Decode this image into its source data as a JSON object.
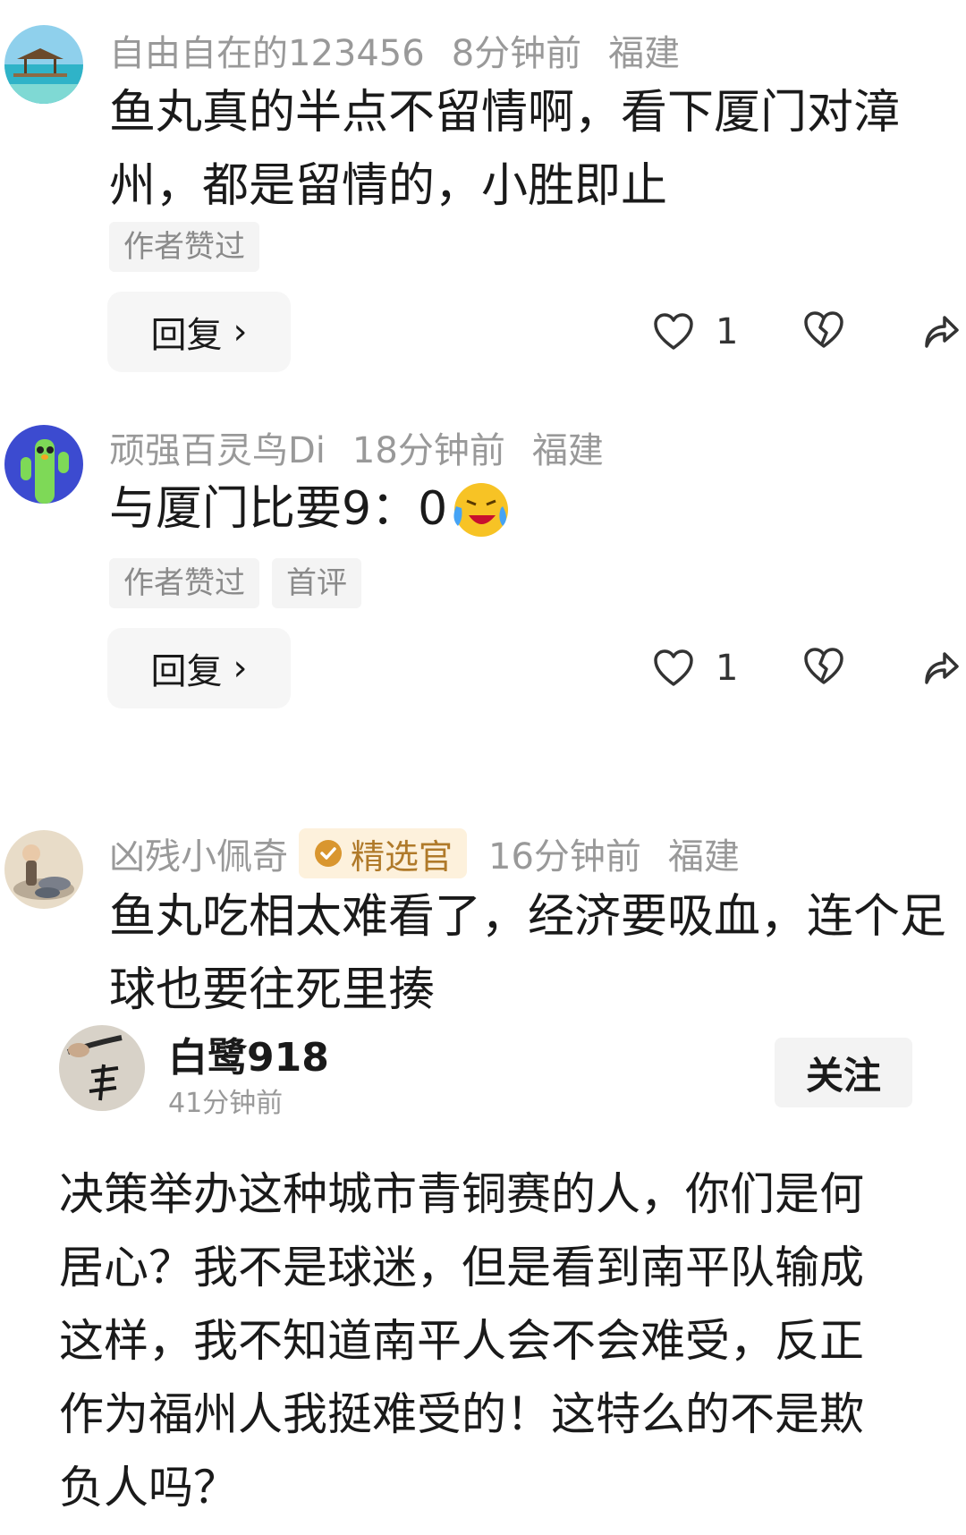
{
  "comments": [
    {
      "username": "自由自在的123456",
      "time": "8分钟前",
      "location": "福建",
      "text": "鱼丸真的半点不留情啊，看下厦门对漳州，都是留情的，小胜即止",
      "tags": [
        "作者赞过"
      ],
      "reply_label": "回复",
      "like_count": "1"
    },
    {
      "username": "顽强百灵鸟Di",
      "time": "18分钟前",
      "location": "福建",
      "text": "与厦门比要9：0",
      "tags": [
        "作者赞过",
        "首评"
      ],
      "reply_label": "回复",
      "like_count": "1"
    },
    {
      "username": "凶残小佩奇",
      "badge": "精选官",
      "time": "16分钟前",
      "location": "福建",
      "text": "鱼丸吃相太难看了，经济要吸血，连个足球也要往死里揍"
    }
  ],
  "post": {
    "author": "白鹭918",
    "time": "41分钟前",
    "follow_label": "关注",
    "text": "决策举办这种城市青铜赛的人，你们是何居心？我不是球迷，但是看到南平队输成这样，我不知道南平人会不会难受，反正作为福州人我挺难受的！这特么的不是欺负人吗？"
  },
  "icons": {
    "like": "heart-outline-icon",
    "dislike": "broken-heart-icon",
    "share": "share-arrow-icon",
    "emoji": "laughing-crying-emoji"
  },
  "colors": {
    "meta_gray": "#999999",
    "badge_bg": "#fdf1dc",
    "badge_text": "#b07a2a",
    "button_bg": "#f6f6f6"
  }
}
